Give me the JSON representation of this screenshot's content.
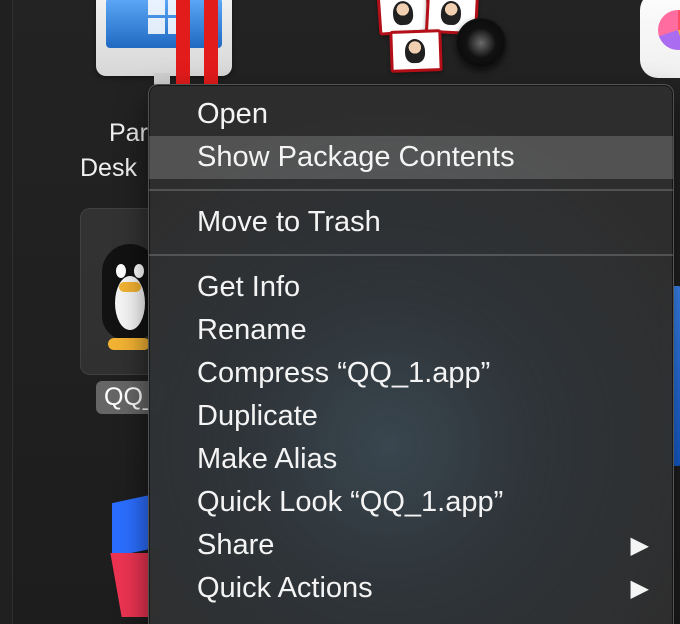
{
  "background": {
    "desktop_labels": {
      "parallels_line_1": "Par",
      "parallels_line_2": "Desk",
      "qq_label": "QQ_"
    }
  },
  "context_menu": {
    "items": [
      {
        "label": "Open"
      },
      {
        "label": "Show Package Contents"
      },
      {
        "label": "Move to Trash"
      },
      {
        "label": "Get Info"
      },
      {
        "label": "Rename"
      },
      {
        "label": "Compress “QQ_1.app”"
      },
      {
        "label": "Duplicate"
      },
      {
        "label": "Make Alias"
      },
      {
        "label": "Quick Look “QQ_1.app”"
      },
      {
        "label": "Share",
        "has_submenu": true
      },
      {
        "label": "Quick Actions",
        "has_submenu": true
      }
    ],
    "highlighted_item": "Show Package Contents",
    "submenu_arrow": "▶"
  }
}
